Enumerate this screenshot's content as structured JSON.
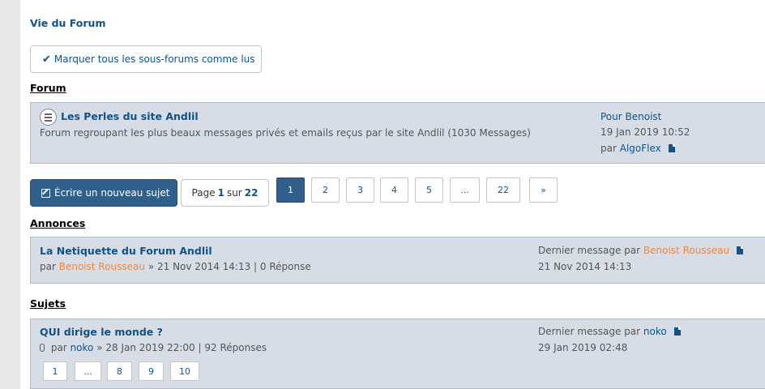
{
  "breadcrumb": "Vie du Forum",
  "mark_all_read_label": "Marquer tous les sous-forums comme lus",
  "forum_section": {
    "title": "Forum",
    "forum": {
      "title": "Les Perles du site Andlil",
      "description": "Forum regroupant les plus beaux messages privés et emails reçus par le site Andlil (1030 Messages)",
      "last_post_title": "Pour Benoist",
      "last_post_date": "19 Jan 2019 10:52",
      "last_post_by": "par",
      "last_post_author": "AlgoFlex"
    }
  },
  "toolbar": {
    "new_topic_label": "Écrire un nouveau sujet",
    "page_word": "Page",
    "current_page": "1",
    "of_word": "sur",
    "total_pages": "22"
  },
  "pagination": [
    "1",
    "2",
    "3",
    "4",
    "5",
    "...",
    "22",
    "»"
  ],
  "announcements": {
    "title": "Annonces",
    "topic": {
      "title": "La Netiquette du Forum Andlil",
      "by": "par",
      "author": "Benoist Rousseau",
      "info": "» 21 Nov 2014 14:13 | 0 Réponse",
      "last_label": "Dernier message par",
      "last_author": "Benoist Rousseau",
      "last_date": "21 Nov 2014 14:13"
    }
  },
  "topics": {
    "title": "Sujets",
    "topic": {
      "title": "QUI dirige le monde ?",
      "by": "par",
      "author": "noko",
      "info": "» 28 Jan 2019 22:00 | 92 Réponses",
      "last_label": "Dernier message par",
      "last_author": "noko",
      "last_date": "29 Jan 2019 02:48",
      "pages": [
        "1",
        "...",
        "8",
        "9",
        "10"
      ]
    }
  },
  "colors": {
    "link": "#105289",
    "panel_bg": "#d6dde7",
    "button_primary": "#2f5f8a",
    "author_orange": "#e88a46"
  }
}
